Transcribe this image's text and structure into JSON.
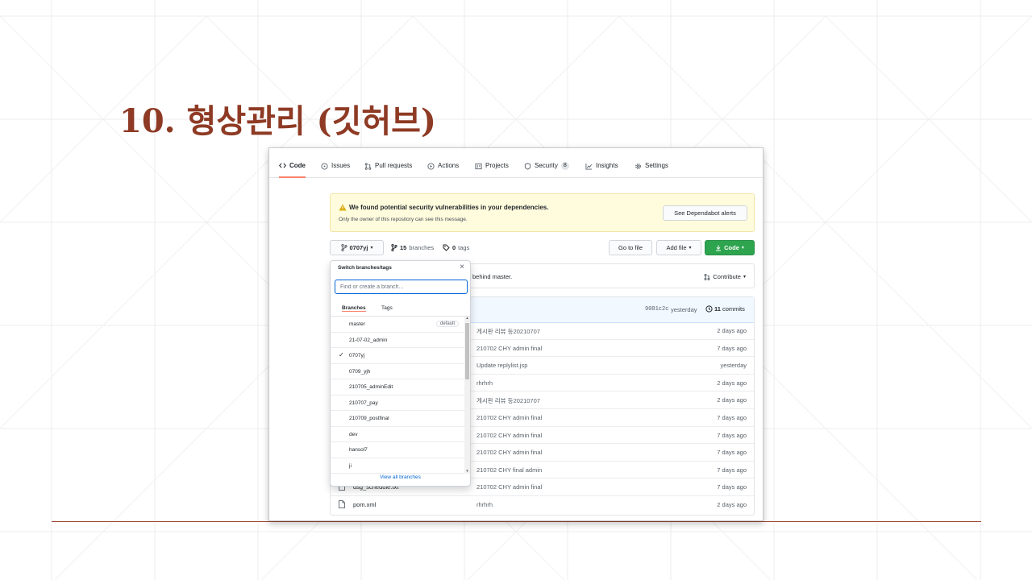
{
  "slide": {
    "title": "10. 형상관리 (깃허브)"
  },
  "nav": {
    "items": [
      {
        "label": "Code",
        "icon": "code-icon"
      },
      {
        "label": "Issues",
        "icon": "issue-icon"
      },
      {
        "label": "Pull requests",
        "icon": "pull-request-icon"
      },
      {
        "label": "Actions",
        "icon": "play-icon"
      },
      {
        "label": "Projects",
        "icon": "project-icon"
      },
      {
        "label": "Security",
        "icon": "shield-icon",
        "count": "8"
      },
      {
        "label": "Insights",
        "icon": "graph-icon"
      },
      {
        "label": "Settings",
        "icon": "gear-icon"
      }
    ]
  },
  "alert": {
    "title": "We found potential security vulnerabilities in your dependencies.",
    "subtitle": "Only the owner of this repository can see this message.",
    "button": "See Dependabot alerts"
  },
  "repo_bar": {
    "branch": "0707yj",
    "branches_count": "15",
    "branches_label": "branches",
    "tags_count": "0",
    "tags_label": "tags",
    "go_to_file": "Go to file",
    "add_file": "Add file",
    "code": "Code"
  },
  "behind": {
    "text": "behind master.",
    "contribute": "Contribute"
  },
  "commit_bar": {
    "hash": "9081c2c",
    "when": "yesterday",
    "commits_count": "11",
    "commits_label": "commits"
  },
  "files": [
    {
      "name": "",
      "message": "게시판 리뷰 등20210707",
      "age": "2 days ago"
    },
    {
      "name": "",
      "message": "210702 CHY admin final",
      "age": "7 days ago"
    },
    {
      "name": "",
      "message": "Update replylist.jsp",
      "age": "yesterday"
    },
    {
      "name": "",
      "message": "rhrhrh",
      "age": "2 days ago"
    },
    {
      "name": "",
      "message": "게시판 리뷰 등20210707",
      "age": "2 days ago"
    },
    {
      "name": "",
      "message": "210702 CHY admin final",
      "age": "7 days ago"
    },
    {
      "name": "",
      "message": "210702 CHY admin final",
      "age": "7 days ago"
    },
    {
      "name": "",
      "message": "210702 CHY admin final",
      "age": "7 days ago"
    },
    {
      "name": "",
      "message": "210702 CHY final admin",
      "age": "7 days ago"
    },
    {
      "name": "dsg_schedule.txt",
      "message": "210702 CHY admin final",
      "age": "7 days ago"
    },
    {
      "name": "pom.xml",
      "message": "rhrhrh",
      "age": "2 days ago"
    }
  ],
  "dropdown": {
    "title": "Switch branches/tags",
    "placeholder": "Find or create a branch...",
    "tab_branches": "Branches",
    "tab_tags": "Tags",
    "items": [
      {
        "name": "master",
        "tag": "default",
        "checked": false
      },
      {
        "name": "21-07-02_admin",
        "tag": "",
        "checked": false
      },
      {
        "name": "0707yj",
        "tag": "",
        "checked": true
      },
      {
        "name": "0709_yjh",
        "tag": "",
        "checked": false
      },
      {
        "name": "210705_adminEdit",
        "tag": "",
        "checked": false
      },
      {
        "name": "210707_pay",
        "tag": "",
        "checked": false
      },
      {
        "name": "210709_postfinal",
        "tag": "",
        "checked": false
      },
      {
        "name": "dev",
        "tag": "",
        "checked": false
      },
      {
        "name": "hansol7",
        "tag": "",
        "checked": false
      },
      {
        "name": "ji",
        "tag": "",
        "checked": false
      }
    ],
    "view_all": "View all branches"
  },
  "colors": {
    "title": "#8e3a24",
    "accent_green": "#2ea44f",
    "link_blue": "#0366d6",
    "tab_underline": "#f9826c"
  }
}
